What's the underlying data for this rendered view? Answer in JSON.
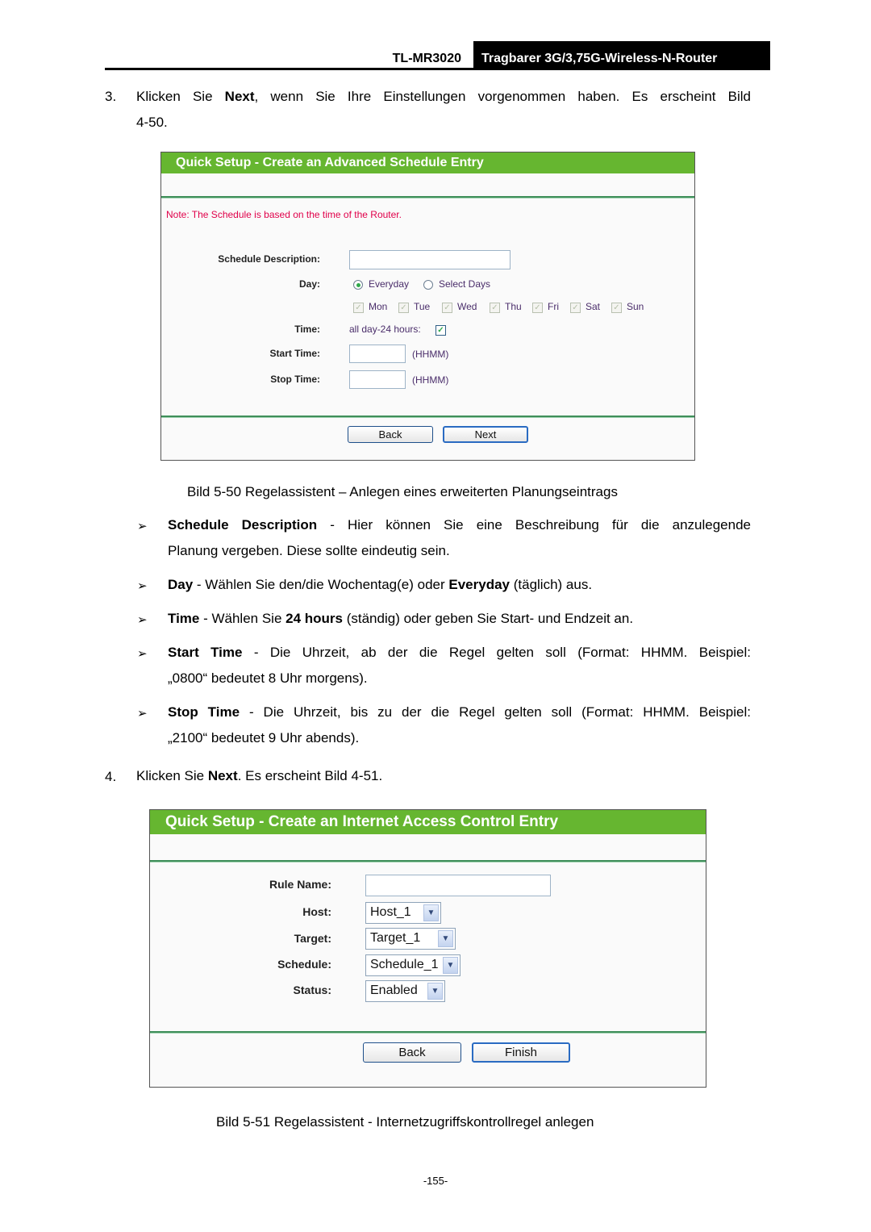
{
  "header": {
    "model": "TL-MR3020",
    "product_title": "Tragbarer 3G/3,75G-Wireless-N-Router"
  },
  "step3": {
    "number": "3.",
    "text_before": "Klicken Sie ",
    "bold": "Next",
    "text_after_line1": ", wenn Sie Ihre Einstellungen vorgenommen haben. Es erscheint Bild",
    "line2": "4-50."
  },
  "figure50": {
    "title": "Quick Setup - Create an Advanced Schedule Entry",
    "note": "Note: The Schedule is based on the time of the Router.",
    "labels": {
      "description": "Schedule Description:",
      "day": "Day:",
      "time": "Time:",
      "start_time": "Start Time:",
      "stop_time": "Stop Time:"
    },
    "description_value": "",
    "day_options": [
      {
        "label": "Everyday",
        "selected": true
      },
      {
        "label": "Select Days",
        "selected": false
      }
    ],
    "weekdays": [
      {
        "label": "Mon",
        "checked": true
      },
      {
        "label": "Tue",
        "checked": true
      },
      {
        "label": "Wed",
        "checked": true
      },
      {
        "label": "Thu",
        "checked": true
      },
      {
        "label": "Fri",
        "checked": true
      },
      {
        "label": "Sat",
        "checked": true
      },
      {
        "label": "Sun",
        "checked": true
      }
    ],
    "all_day_label": "all day-24 hours:",
    "all_day_checked": true,
    "start_time_value": "",
    "stop_time_value": "",
    "format_hint": "(HHMM)",
    "buttons": {
      "back": "Back",
      "next": "Next"
    },
    "caption": "Bild 5-50 Regelassistent – Anlegen eines erweiterten Planungseintrags"
  },
  "bullets": [
    {
      "bold": "Schedule Description",
      "text": " - Hier können Sie eine Beschreibung für die anzulegende",
      "line2": "Planung vergeben. Diese sollte eindeutig sein."
    },
    {
      "bold": "Day",
      "text": " - Wählen Sie den/die Wochentag(e) oder ",
      "bold2": "Everyday",
      "text2": " (täglich) aus."
    },
    {
      "bold": "Time",
      "text": " - Wählen Sie ",
      "bold2": "24 hours",
      "text2": " (ständig) oder geben Sie Start- und Endzeit an."
    },
    {
      "bold": "Start Time",
      "text": " - Die Uhrzeit, ab der die Regel gelten soll (Format: HHMM. Beispiel:",
      "line2": "„0800“ bedeutet 8 Uhr morgens)."
    },
    {
      "bold": "Stop Time",
      "text": " - Die Uhrzeit, bis zu der die Regel gelten soll (Format: HHMM. Beispiel:",
      "line2": "„2100“ bedeutet 9 Uhr abends)."
    }
  ],
  "bullet_glyph": "➢",
  "step4": {
    "number": "4.",
    "text_before": "Klicken Sie ",
    "bold": "Next",
    "text_after": ". Es erscheint Bild 4-51."
  },
  "figure51": {
    "title": "Quick Setup - Create an Internet Access Control Entry",
    "labels": {
      "rule_name": "Rule Name:",
      "host": "Host:",
      "target": "Target:",
      "schedule": "Schedule:",
      "status": "Status:"
    },
    "rule_name_value": "",
    "host_value": "Host_1",
    "target_value": "Target_1",
    "schedule_value": "Schedule_1",
    "status_value": "Enabled",
    "buttons": {
      "back": "Back",
      "finish": "Finish"
    },
    "caption": "Bild 5-51 Regelassistent - Internetzugriffskontrollregel anlegen"
  },
  "page_number": "-155-"
}
